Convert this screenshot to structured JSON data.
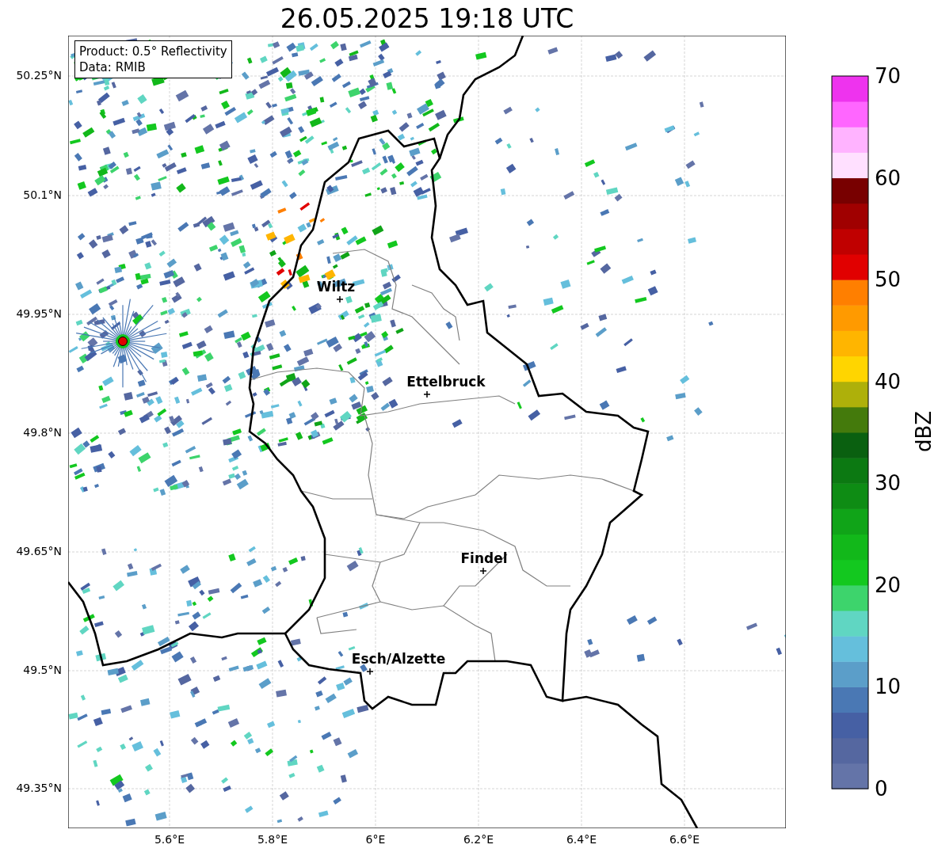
{
  "title": "26.05.2025 19:18 UTC",
  "info_box": [
    "Product: 0.5° Reflectivity",
    "Data: RMIB"
  ],
  "y_ticks": [
    "50.25°N",
    "50.1°N",
    "49.95°N",
    "49.8°N",
    "49.65°N",
    "49.5°N",
    "49.35°N"
  ],
  "x_ticks": [
    "5.6°E",
    "5.8°E",
    "6°E",
    "6.2°E",
    "6.4°E",
    "6.6°E"
  ],
  "cities": [
    {
      "name": "Wiltz"
    },
    {
      "name": "Ettelbruck"
    },
    {
      "name": "Findel"
    },
    {
      "name": "Esch/Alzette"
    }
  ],
  "colorbar": {
    "label": "dBZ",
    "ticks": [
      "70",
      "60",
      "50",
      "40",
      "30",
      "20",
      "10",
      "0"
    ],
    "segments": [
      {
        "color": "#6474a8"
      },
      {
        "color": "#5567a0"
      },
      {
        "color": "#4660a4"
      },
      {
        "color": "#4a78b4"
      },
      {
        "color": "#5b9ec9"
      },
      {
        "color": "#65bfdc"
      },
      {
        "color": "#60d6c2"
      },
      {
        "color": "#3dd46c"
      },
      {
        "color": "#13c81f"
      },
      {
        "color": "#12b81a"
      },
      {
        "color": "#10a418"
      },
      {
        "color": "#0e8c14"
      },
      {
        "color": "#0c7912"
      },
      {
        "color": "#0a6010"
      },
      {
        "color": "#447a0c"
      },
      {
        "color": "#aeb00a"
      },
      {
        "color": "#ffd500"
      },
      {
        "color": "#ffb500"
      },
      {
        "color": "#ff9a00"
      },
      {
        "color": "#ff7f00"
      },
      {
        "color": "#e10000"
      },
      {
        "color": "#c00000"
      },
      {
        "color": "#a00000"
      },
      {
        "color": "#780000"
      },
      {
        "color": "#ffe0ff"
      },
      {
        "color": "#ffb3ff"
      },
      {
        "color": "#ff66ff"
      },
      {
        "color": "#ee33ee"
      }
    ]
  }
}
